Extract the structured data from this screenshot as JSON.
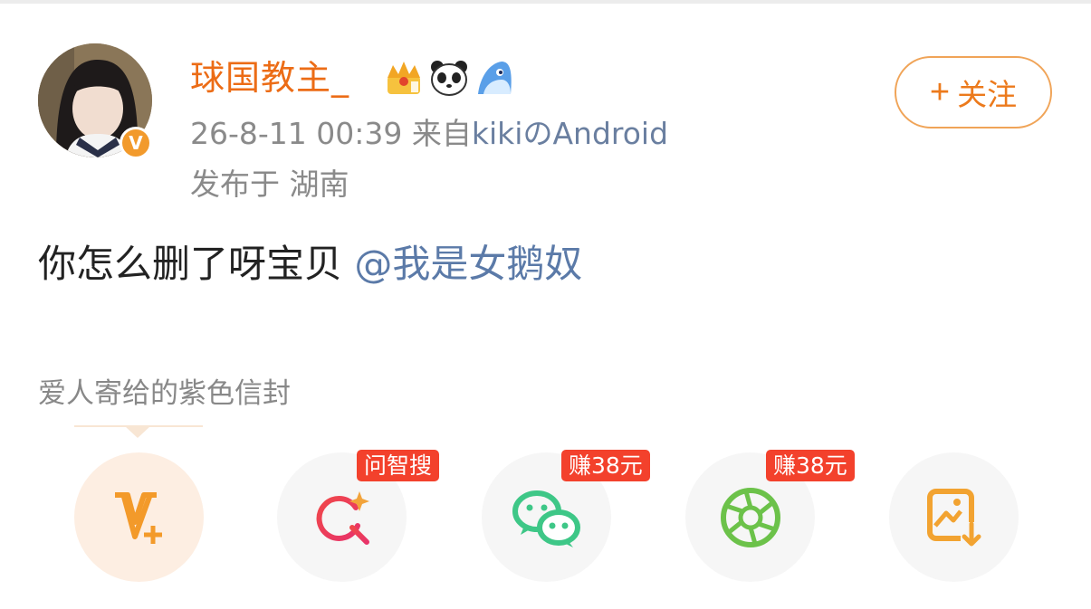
{
  "post": {
    "username": "球国教主_",
    "timestamp": "26-8-11 00:39",
    "source_prefix": "来自",
    "source": "kikiのAndroid",
    "location": "发布于 湖南",
    "text": "你怎么删了呀宝贝",
    "mention": "@我是女鹅奴",
    "subtitle": "爱人寄给的紫色信封",
    "verified_mark": "V",
    "badges": [
      "crown-badge",
      "panda-badge",
      "shark-badge"
    ]
  },
  "follow_button": {
    "plus": "+",
    "label": "关注"
  },
  "share": {
    "items": [
      {
        "icon": "vplus-icon",
        "tag": ""
      },
      {
        "icon": "ai-search-icon",
        "tag": "问智搜"
      },
      {
        "icon": "wechat-icon",
        "tag": "赚38元"
      },
      {
        "icon": "moments-icon",
        "tag": "赚38元"
      },
      {
        "icon": "save-image-icon",
        "tag": ""
      }
    ]
  },
  "colors": {
    "username": "#ec6c16",
    "follow_border": "#f0a458",
    "mention": "#5b7aa8",
    "tag_bg": "#f3412c",
    "wechat": "#3ec787",
    "moments": "#6cc24a",
    "accent": "#f29a2c"
  }
}
